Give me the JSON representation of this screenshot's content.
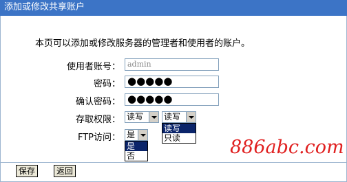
{
  "window": {
    "title": "添加或修改共享账户"
  },
  "intro": "本页可以添加或修改服务器的管理者和使用者的账户。",
  "form": {
    "username_label": "使用者账号：",
    "username_value": "admin",
    "password_label": "密码：",
    "password_value": "●●●●●",
    "confirm_label": "确认密码：",
    "confirm_value": "●●●●●",
    "access_label": "存取权限：",
    "access_select1": "读写",
    "access_select2": "读写",
    "access_options": [
      "读写",
      "只读"
    ],
    "ftp_label": "FTP访问：",
    "ftp_select": "是",
    "ftp_options": [
      "是",
      "否"
    ]
  },
  "buttons": {
    "save": "保存",
    "back": "返回"
  },
  "watermark": {
    "brand": "886abc.com"
  },
  "colors": {
    "titlebar": "#3c74c6",
    "highlight": "#0a246a",
    "logo": "#e02020"
  }
}
